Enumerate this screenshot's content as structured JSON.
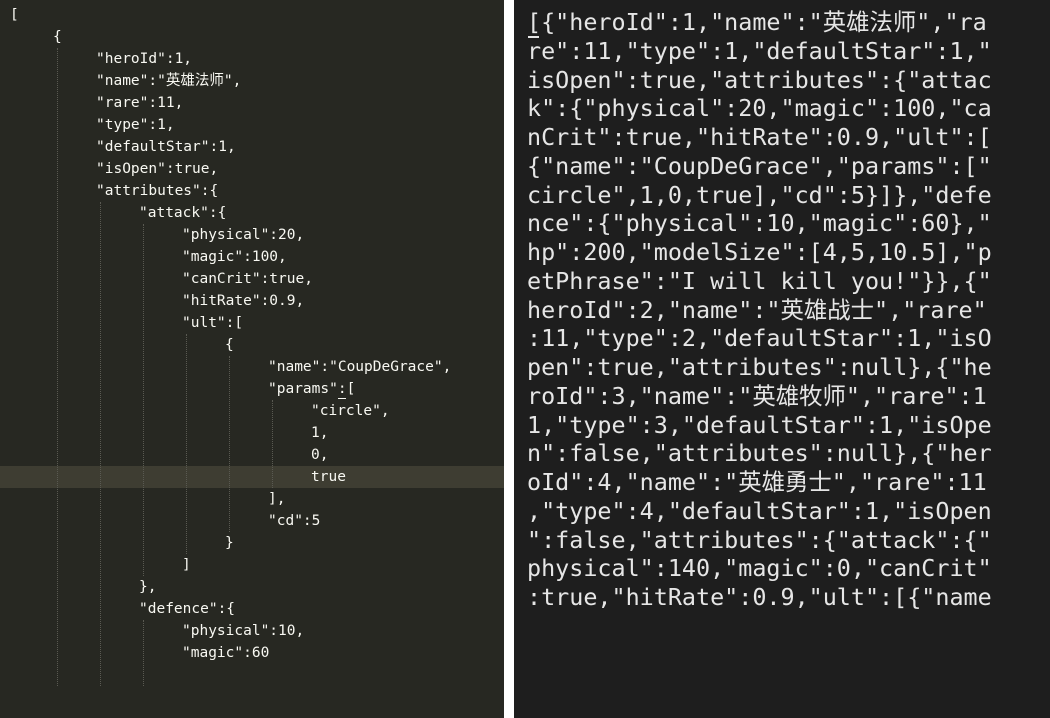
{
  "left_editor": {
    "lines": [
      {
        "indent": 0,
        "text": "["
      },
      {
        "indent": 1,
        "text": "{"
      },
      {
        "indent": 2,
        "text": "\"heroId\":1,"
      },
      {
        "indent": 2,
        "text": "\"name\":\"英雄法师\","
      },
      {
        "indent": 2,
        "text": "\"rare\":11,"
      },
      {
        "indent": 2,
        "text": "\"type\":1,"
      },
      {
        "indent": 2,
        "text": "\"defaultStar\":1,"
      },
      {
        "indent": 2,
        "text": "\"isOpen\":true,"
      },
      {
        "indent": 2,
        "text": "\"attributes\":{"
      },
      {
        "indent": 3,
        "text": "\"attack\":{"
      },
      {
        "indent": 4,
        "text": "\"physical\":20,"
      },
      {
        "indent": 4,
        "text": "\"magic\":100,"
      },
      {
        "indent": 4,
        "text": "\"canCrit\":true,"
      },
      {
        "indent": 4,
        "text": "\"hitRate\":0.9,"
      },
      {
        "indent": 4,
        "text": "\"ult\":["
      },
      {
        "indent": 5,
        "text": "{"
      },
      {
        "indent": 6,
        "text": "\"name\":\"CoupDeGrace\","
      },
      {
        "indent": 6,
        "text": "\"params\":["
      },
      {
        "indent": 7,
        "text": "\"circle\","
      },
      {
        "indent": 7,
        "text": "1,"
      },
      {
        "indent": 7,
        "text": "0,"
      },
      {
        "indent": 7,
        "text": "true",
        "highlight": true
      },
      {
        "indent": 6,
        "text": "],"
      },
      {
        "indent": 6,
        "text": "\"cd\":5"
      },
      {
        "indent": 5,
        "text": "}"
      },
      {
        "indent": 4,
        "text": "]"
      },
      {
        "indent": 3,
        "text": "},"
      },
      {
        "indent": 3,
        "text": "\"defence\":{"
      },
      {
        "indent": 4,
        "text": "\"physical\":10,"
      },
      {
        "indent": 4,
        "text": "\"magic\":60"
      },
      {
        "indent": 4,
        "text": ""
      }
    ]
  },
  "right_editor": {
    "lines": [
      "[{\"heroId\":1,\"name\":\"英雄法师\",\"ra",
      "re\":11,\"type\":1,\"defaultStar\":1,\"",
      "isOpen\":true,\"attributes\":{\"attac",
      "k\":{\"physical\":20,\"magic\":100,\"ca",
      "nCrit\":true,\"hitRate\":0.9,\"ult\":[",
      "{\"name\":\"CoupDeGrace\",\"params\":[\"",
      "circle\",1,0,true],\"cd\":5}]},\"defe",
      "nce\":{\"physical\":10,\"magic\":60},\"",
      "hp\":200,\"modelSize\":[4,5,10.5],\"p",
      "etPhrase\":\"I will kill you!\"}},{\"",
      "heroId\":2,\"name\":\"英雄战士\",\"rare\"",
      ":11,\"type\":2,\"defaultStar\":1,\"isO",
      "pen\":true,\"attributes\":null},{\"he",
      "roId\":3,\"name\":\"英雄牧师\",\"rare\":1",
      "1,\"type\":3,\"defaultStar\":1,\"isOpe",
      "n\":false,\"attributes\":null},{\"her",
      "oId\":4,\"name\":\"英雄勇士\",\"rare\":11",
      ",\"type\":4,\"defaultStar\":1,\"isOpen",
      "\":false,\"attributes\":{\"attack\":{\"",
      "physical\":140,\"magic\":0,\"canCrit\"",
      ":true,\"hitRate\":0.9,\"ult\":[{\"name"
    ]
  },
  "colors": {
    "left_bg": "#272822",
    "left_fg": "#f8f8f2",
    "right_bg": "#1e1e1e",
    "right_fg": "#e6e6e6",
    "highlight": "#3e3d32"
  }
}
